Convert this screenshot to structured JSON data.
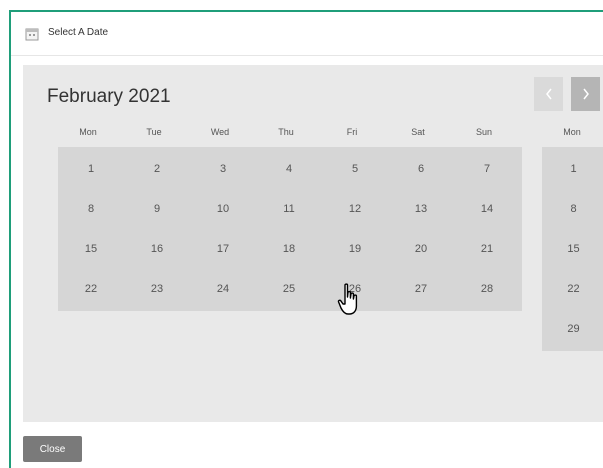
{
  "dialog": {
    "title": "Select A Date",
    "close_label": "Close"
  },
  "calendar": {
    "month_title": "February 2021",
    "prev_label": "<",
    "next_label": ">",
    "weekdays": [
      "Mon",
      "Tue",
      "Wed",
      "Thu",
      "Fri",
      "Sat",
      "Sun"
    ],
    "next_month_weekday": "Mon",
    "weeks": [
      [
        "1",
        "2",
        "3",
        "4",
        "5",
        "6",
        "7"
      ],
      [
        "8",
        "9",
        "10",
        "11",
        "12",
        "13",
        "14"
      ],
      [
        "15",
        "16",
        "17",
        "18",
        "19",
        "20",
        "21"
      ],
      [
        "22",
        "23",
        "24",
        "25",
        "26",
        "27",
        "28"
      ]
    ],
    "next_month_days": [
      "1",
      "8",
      "15",
      "22",
      "29"
    ]
  },
  "colors": {
    "accent_border": "#1f9e7a",
    "calendar_background": "#e9e9e9",
    "day_cell": "#d6d6d6",
    "close_button": "#7a7a7a"
  },
  "icons": [
    "calendar-icon",
    "chevron-left-icon",
    "chevron-right-icon",
    "hand-pointer-icon"
  ]
}
